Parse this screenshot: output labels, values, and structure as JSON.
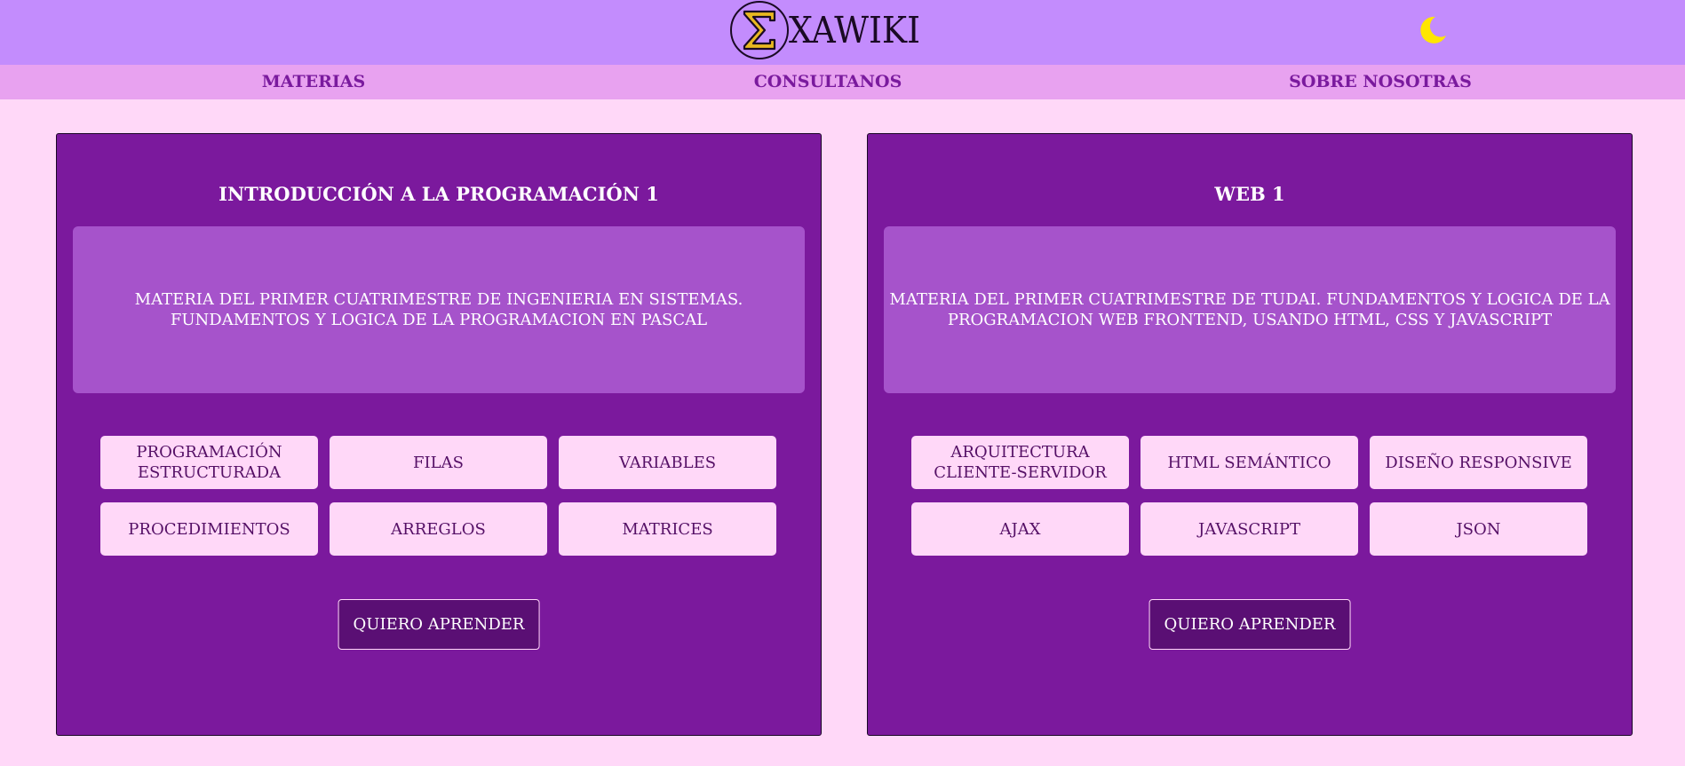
{
  "header": {
    "logo_text": "XAWIKI",
    "logo_icon": "sigma-icon",
    "theme_toggle_icon": "moon-icon"
  },
  "nav": {
    "items": [
      {
        "label": "MATERIAS"
      },
      {
        "label": "CONSULTANOS"
      },
      {
        "label": "SOBRE NOSOTRAS"
      }
    ]
  },
  "cards": [
    {
      "title": "INTRODUCCIÓN A LA PROGRAMACIÓN 1",
      "description": "MATERIA DEL PRIMER CUATRIMESTRE DE INGENIERIA EN SISTEMAS. FUNDAMENTOS Y LOGICA DE LA PROGRAMACION EN PASCAL",
      "topics": [
        "PROGRAMACIÓN ESTRUCTURADA",
        "FILAS",
        "VARIABLES",
        "PROCEDIMIENTOS",
        "ARREGLOS",
        "MATRICES"
      ],
      "button_label": "QUIERO APRENDER"
    },
    {
      "title": "WEB 1",
      "description": "MATERIA DEL PRIMER CUATRIMESTRE DE TUDAI. FUNDAMENTOS Y LOGICA DE LA PROGRAMACION WEB FRONTEND, USANDO HTML, CSS Y JAVASCRIPT",
      "topics": [
        "ARQUITECTURA CLIENTE-SERVIDOR",
        "HTML SEMÁNTICO",
        "DISEÑO RESPONSIVE",
        "AJAX",
        "JAVASCRIPT",
        "JSON"
      ],
      "button_label": "QUIERO APRENDER"
    }
  ],
  "colors": {
    "header_bg": "#c38cfd",
    "nav_bg": "#e8a2f0",
    "page_bg": "#ffd8f8",
    "card_bg": "#7b199d",
    "desc_bg": "#a653cb",
    "button_bg": "#5a0f74",
    "moon": "#ffe600",
    "logo_sigma": "#e8b820"
  }
}
